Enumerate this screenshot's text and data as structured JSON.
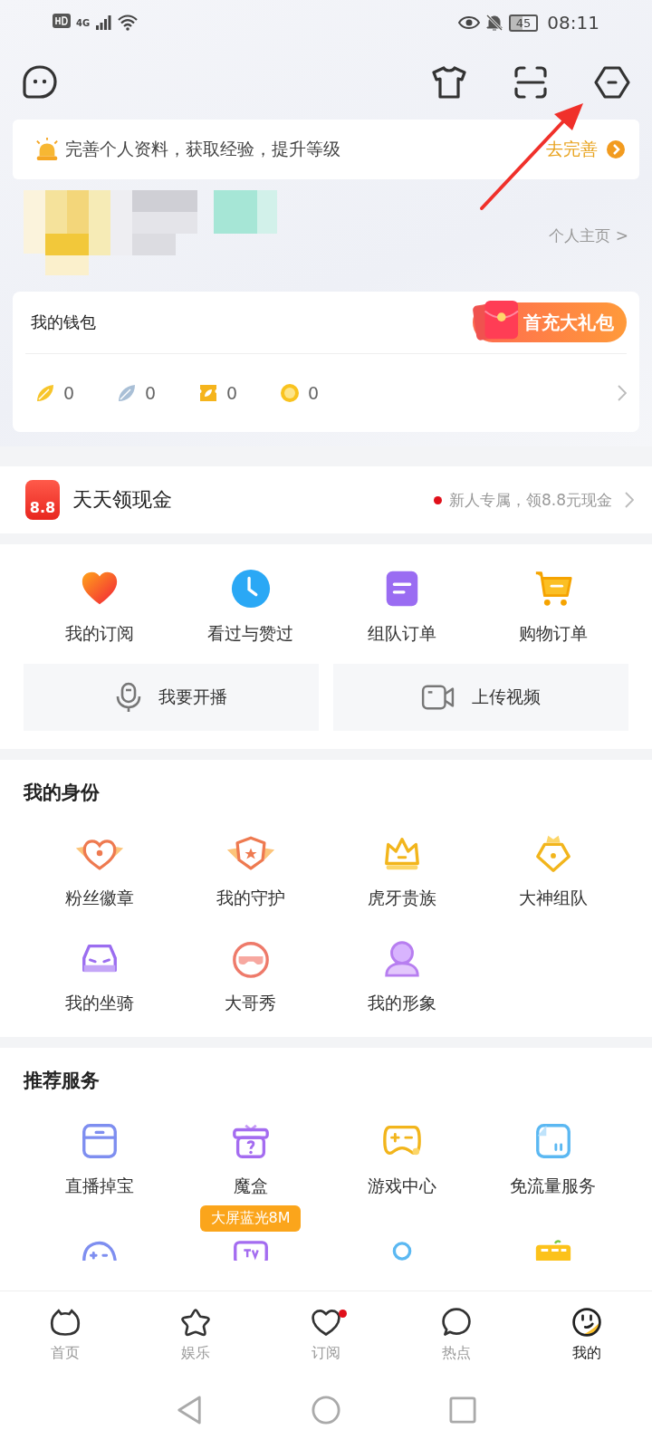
{
  "status_bar": {
    "network": "4G",
    "battery": "45",
    "time": "08:11"
  },
  "tip_banner": {
    "text": "完善个人资料，获取经验，提升等级",
    "action": "去完善"
  },
  "profile": {
    "link": "个人主页 >"
  },
  "wallet": {
    "title": "我的钱包",
    "promo": "首充大礼包",
    "balances": [
      {
        "value": "0"
      },
      {
        "value": "0"
      },
      {
        "value": "0"
      },
      {
        "value": "0"
      }
    ]
  },
  "cash_row": {
    "title": "天天领现金",
    "icon_text": "8.8",
    "note": "新人专属，领8.8元现金"
  },
  "quick_links": [
    {
      "label": "我的订阅"
    },
    {
      "label": "看过与赞过"
    },
    {
      "label": "组队订单"
    },
    {
      "label": "购物订单"
    }
  ],
  "actions": [
    {
      "label": "我要开播"
    },
    {
      "label": "上传视频"
    }
  ],
  "identity": {
    "title": "我的身份",
    "items": [
      {
        "label": "粉丝徽章"
      },
      {
        "label": "我的守护"
      },
      {
        "label": "虎牙贵族"
      },
      {
        "label": "大神组队"
      },
      {
        "label": "我的坐骑"
      },
      {
        "label": "大哥秀"
      },
      {
        "label": "我的形象"
      }
    ]
  },
  "services": {
    "title": "推荐服务",
    "items": [
      {
        "label": "直播掉宝"
      },
      {
        "label": "魔盒"
      },
      {
        "label": "游戏中心"
      },
      {
        "label": "免流量服务"
      }
    ],
    "promo_badge": "大屏蓝光8M"
  },
  "bottom_nav": [
    {
      "label": "首页",
      "selected": false,
      "dot": false
    },
    {
      "label": "娱乐",
      "selected": false,
      "dot": false
    },
    {
      "label": "订阅",
      "selected": false,
      "dot": true
    },
    {
      "label": "热点",
      "selected": false,
      "dot": false
    },
    {
      "label": "我的",
      "selected": true,
      "dot": false
    }
  ]
}
